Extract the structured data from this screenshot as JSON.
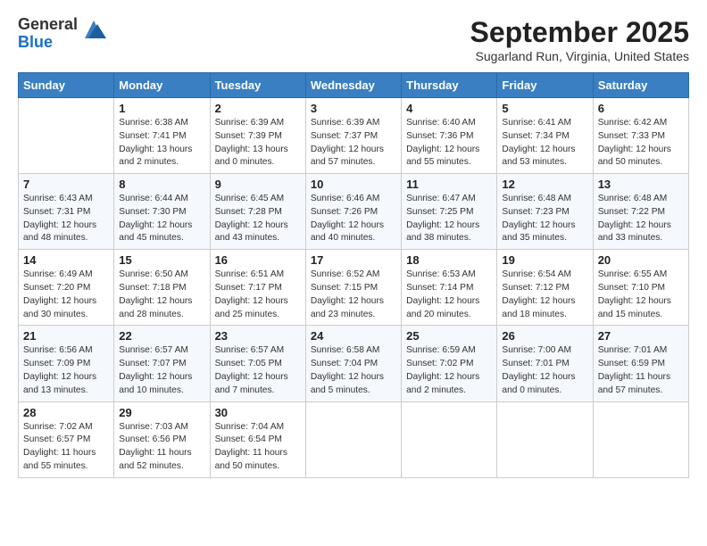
{
  "logo": {
    "general": "General",
    "blue": "Blue"
  },
  "title": "September 2025",
  "location": "Sugarland Run, Virginia, United States",
  "days_of_week": [
    "Sunday",
    "Monday",
    "Tuesday",
    "Wednesday",
    "Thursday",
    "Friday",
    "Saturday"
  ],
  "weeks": [
    [
      {
        "day": "",
        "info": ""
      },
      {
        "day": "1",
        "info": "Sunrise: 6:38 AM\nSunset: 7:41 PM\nDaylight: 13 hours\nand 2 minutes."
      },
      {
        "day": "2",
        "info": "Sunrise: 6:39 AM\nSunset: 7:39 PM\nDaylight: 13 hours\nand 0 minutes."
      },
      {
        "day": "3",
        "info": "Sunrise: 6:39 AM\nSunset: 7:37 PM\nDaylight: 12 hours\nand 57 minutes."
      },
      {
        "day": "4",
        "info": "Sunrise: 6:40 AM\nSunset: 7:36 PM\nDaylight: 12 hours\nand 55 minutes."
      },
      {
        "day": "5",
        "info": "Sunrise: 6:41 AM\nSunset: 7:34 PM\nDaylight: 12 hours\nand 53 minutes."
      },
      {
        "day": "6",
        "info": "Sunrise: 6:42 AM\nSunset: 7:33 PM\nDaylight: 12 hours\nand 50 minutes."
      }
    ],
    [
      {
        "day": "7",
        "info": "Sunrise: 6:43 AM\nSunset: 7:31 PM\nDaylight: 12 hours\nand 48 minutes."
      },
      {
        "day": "8",
        "info": "Sunrise: 6:44 AM\nSunset: 7:30 PM\nDaylight: 12 hours\nand 45 minutes."
      },
      {
        "day": "9",
        "info": "Sunrise: 6:45 AM\nSunset: 7:28 PM\nDaylight: 12 hours\nand 43 minutes."
      },
      {
        "day": "10",
        "info": "Sunrise: 6:46 AM\nSunset: 7:26 PM\nDaylight: 12 hours\nand 40 minutes."
      },
      {
        "day": "11",
        "info": "Sunrise: 6:47 AM\nSunset: 7:25 PM\nDaylight: 12 hours\nand 38 minutes."
      },
      {
        "day": "12",
        "info": "Sunrise: 6:48 AM\nSunset: 7:23 PM\nDaylight: 12 hours\nand 35 minutes."
      },
      {
        "day": "13",
        "info": "Sunrise: 6:48 AM\nSunset: 7:22 PM\nDaylight: 12 hours\nand 33 minutes."
      }
    ],
    [
      {
        "day": "14",
        "info": "Sunrise: 6:49 AM\nSunset: 7:20 PM\nDaylight: 12 hours\nand 30 minutes."
      },
      {
        "day": "15",
        "info": "Sunrise: 6:50 AM\nSunset: 7:18 PM\nDaylight: 12 hours\nand 28 minutes."
      },
      {
        "day": "16",
        "info": "Sunrise: 6:51 AM\nSunset: 7:17 PM\nDaylight: 12 hours\nand 25 minutes."
      },
      {
        "day": "17",
        "info": "Sunrise: 6:52 AM\nSunset: 7:15 PM\nDaylight: 12 hours\nand 23 minutes."
      },
      {
        "day": "18",
        "info": "Sunrise: 6:53 AM\nSunset: 7:14 PM\nDaylight: 12 hours\nand 20 minutes."
      },
      {
        "day": "19",
        "info": "Sunrise: 6:54 AM\nSunset: 7:12 PM\nDaylight: 12 hours\nand 18 minutes."
      },
      {
        "day": "20",
        "info": "Sunrise: 6:55 AM\nSunset: 7:10 PM\nDaylight: 12 hours\nand 15 minutes."
      }
    ],
    [
      {
        "day": "21",
        "info": "Sunrise: 6:56 AM\nSunset: 7:09 PM\nDaylight: 12 hours\nand 13 minutes."
      },
      {
        "day": "22",
        "info": "Sunrise: 6:57 AM\nSunset: 7:07 PM\nDaylight: 12 hours\nand 10 minutes."
      },
      {
        "day": "23",
        "info": "Sunrise: 6:57 AM\nSunset: 7:05 PM\nDaylight: 12 hours\nand 7 minutes."
      },
      {
        "day": "24",
        "info": "Sunrise: 6:58 AM\nSunset: 7:04 PM\nDaylight: 12 hours\nand 5 minutes."
      },
      {
        "day": "25",
        "info": "Sunrise: 6:59 AM\nSunset: 7:02 PM\nDaylight: 12 hours\nand 2 minutes."
      },
      {
        "day": "26",
        "info": "Sunrise: 7:00 AM\nSunset: 7:01 PM\nDaylight: 12 hours\nand 0 minutes."
      },
      {
        "day": "27",
        "info": "Sunrise: 7:01 AM\nSunset: 6:59 PM\nDaylight: 11 hours\nand 57 minutes."
      }
    ],
    [
      {
        "day": "28",
        "info": "Sunrise: 7:02 AM\nSunset: 6:57 PM\nDaylight: 11 hours\nand 55 minutes."
      },
      {
        "day": "29",
        "info": "Sunrise: 7:03 AM\nSunset: 6:56 PM\nDaylight: 11 hours\nand 52 minutes."
      },
      {
        "day": "30",
        "info": "Sunrise: 7:04 AM\nSunset: 6:54 PM\nDaylight: 11 hours\nand 50 minutes."
      },
      {
        "day": "",
        "info": ""
      },
      {
        "day": "",
        "info": ""
      },
      {
        "day": "",
        "info": ""
      },
      {
        "day": "",
        "info": ""
      }
    ]
  ]
}
